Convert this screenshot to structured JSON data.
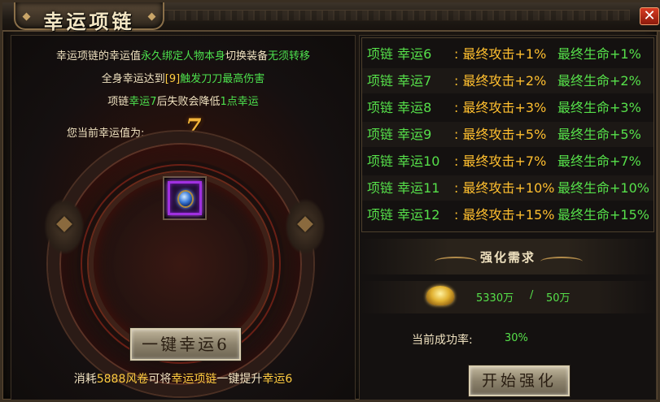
{
  "window": {
    "title": "幸运项链",
    "close_label": "✕"
  },
  "left": {
    "info": {
      "line1_a": "幸运项链的幸运值",
      "line1_b": "永久绑定人物本身",
      "line1_c": "切换装备",
      "line1_d": "无须转移",
      "line2_a": "全身幸运达到",
      "line2_b": "[9]",
      "line2_c": "触发刀刀最高伤害",
      "line3_a": "项链",
      "line3_b": "幸运7",
      "line3_c": "后失败会降低",
      "line3_d": "1点幸运"
    },
    "luck_label": "您当前幸运值为:",
    "luck_value": "7",
    "item": {
      "name": "幸运项链",
      "icon": "necklace-icon",
      "quality_color": "#a030e0"
    },
    "onekey_button": "一键幸运6",
    "cost": {
      "a": "消耗",
      "b": "5888风卷",
      "c": "可将",
      "d": "幸运项链",
      "e": "一键提升",
      "f": "幸运6"
    }
  },
  "right": {
    "luck_table": [
      {
        "name": "项链 幸运6",
        "attack": ": 最终攻击+1%",
        "hp": "最终生命+1%"
      },
      {
        "name": "项链 幸运7",
        "attack": ": 最终攻击+2%",
        "hp": "最终生命+2%"
      },
      {
        "name": "项链 幸运8",
        "attack": ": 最终攻击+3%",
        "hp": "最终生命+3%"
      },
      {
        "name": "项链 幸运9",
        "attack": ": 最终攻击+5%",
        "hp": "最终生命+5%"
      },
      {
        "name": "项链 幸运10",
        "attack": ": 最终攻击+7%",
        "hp": "最终生命+7%"
      },
      {
        "name": "项链 幸运11",
        "attack": ": 最终攻击+10%",
        "hp": "最终生命+10%"
      },
      {
        "name": "项链 幸运12",
        "attack": ": 最终攻击+15%",
        "hp": "最终生命+15%"
      }
    ],
    "requirement_title": "强化需求",
    "gold": {
      "icon": "gold-ingot-icon",
      "owned": "5330万",
      "separator": "/",
      "required": "50万"
    },
    "success_rate_label": "当前成功率:",
    "success_rate_value": "30%",
    "start_button": "开始强化"
  }
}
